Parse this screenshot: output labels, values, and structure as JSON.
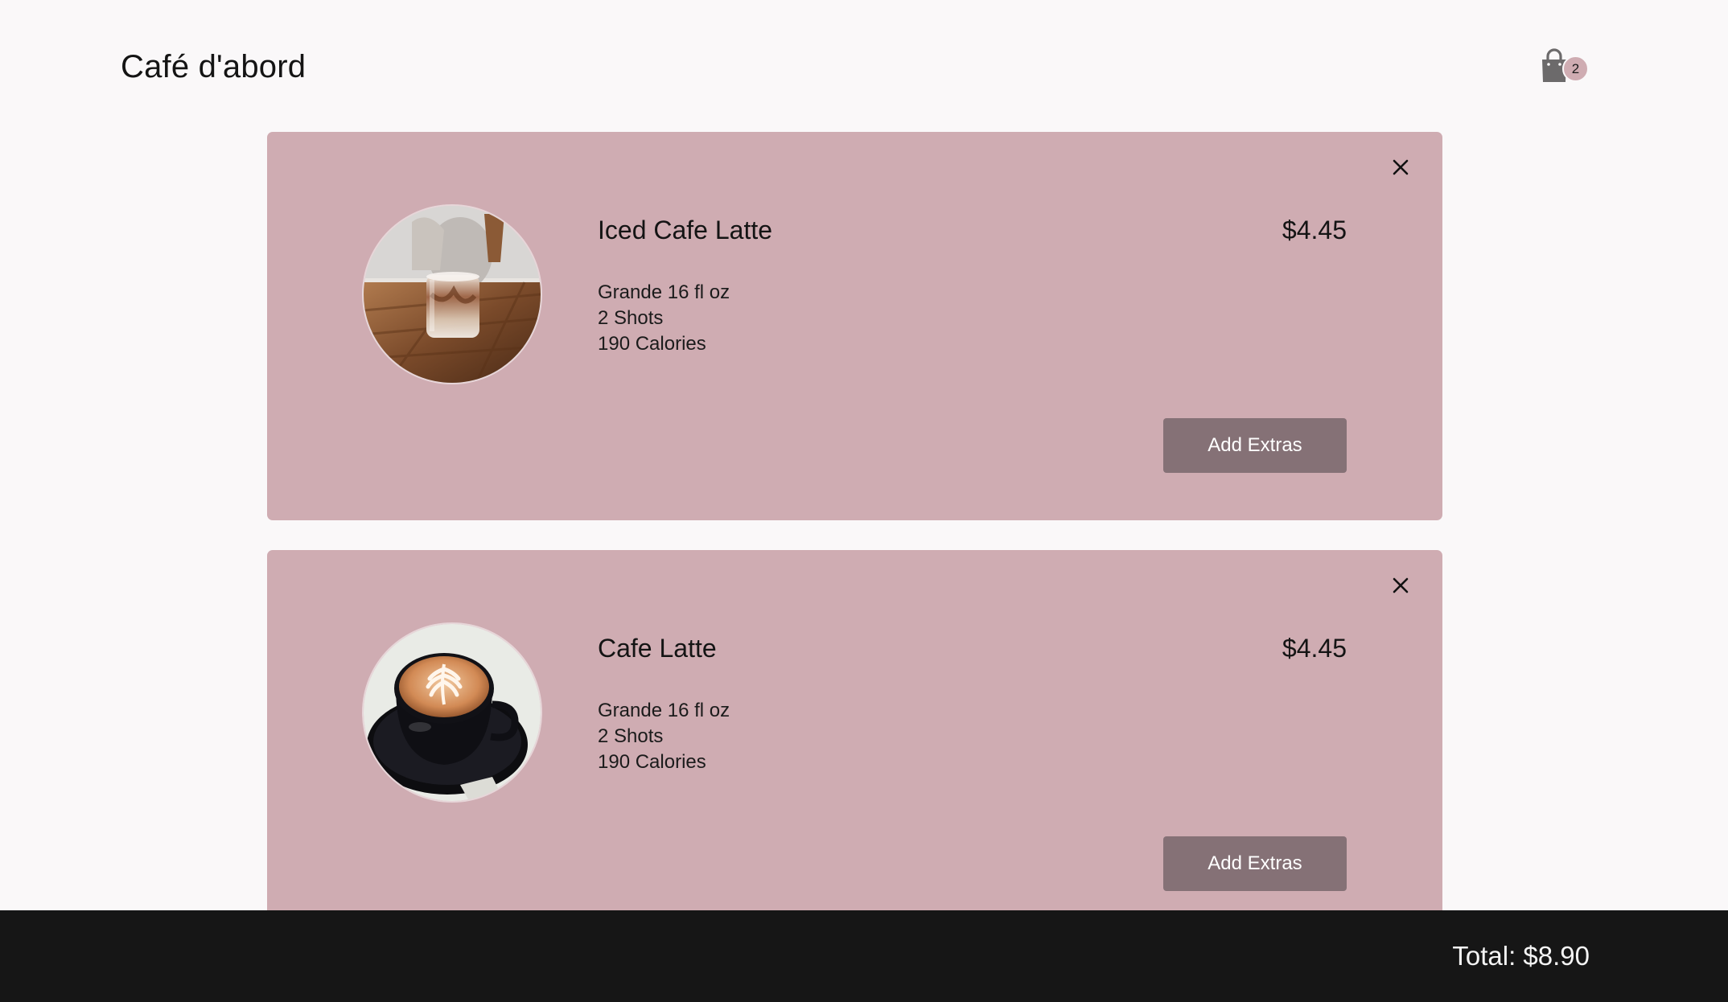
{
  "header": {
    "brand": "Café d'abord",
    "cart": {
      "icon": "shopping-bag-icon",
      "count": "2"
    }
  },
  "cart_items": [
    {
      "name": "Iced Cafe Latte",
      "price": "$4.45",
      "details": [
        "Grande 16 fl oz",
        "2 Shots",
        "190 Calories"
      ],
      "button_label": "Add Extras",
      "close_icon": "close-icon",
      "image": "iced-latte-photo"
    },
    {
      "name": "Cafe Latte",
      "price": "$4.45",
      "details": [
        "Grande 16 fl oz",
        "2 Shots",
        "190 Calories"
      ],
      "button_label": "Add Extras",
      "close_icon": "close-icon",
      "image": "latte-art-photo"
    }
  ],
  "footer": {
    "total": "Total: $8.90"
  },
  "colors": {
    "background": "#faf8f9",
    "card": "#cfacb2",
    "button": "#857176",
    "footer": "#161616"
  }
}
